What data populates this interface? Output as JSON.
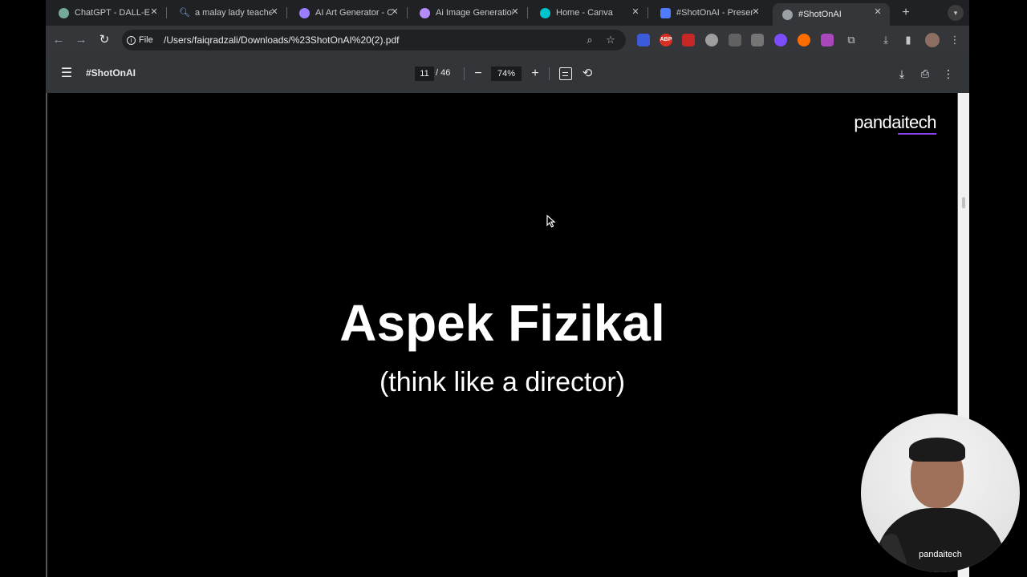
{
  "tabs": [
    {
      "title": "ChatGPT - DALL-E",
      "favicon_color": "#74aa9c"
    },
    {
      "title": "a malay lady teacher",
      "favicon_color": "#4285f4"
    },
    {
      "title": "AI Art Generator - Cr",
      "favicon_color": "#9c7cff"
    },
    {
      "title": "Ai Image Generation",
      "favicon_color": "#b58cff"
    },
    {
      "title": "Home - Canva",
      "favicon_color": "#00c4cc"
    },
    {
      "title": "#ShotOnAI - Presen",
      "favicon_color": "#4f7cff"
    },
    {
      "title": "#ShotOnAI",
      "favicon_color": "#9aa0a6",
      "active": true
    }
  ],
  "toolbar": {
    "file_chip": "File",
    "url": "/Users/faiqradzali/Downloads/%23ShotOnAI%20(2).pdf",
    "ext_abp": "ABP"
  },
  "pdf": {
    "title": "#ShotOnAI",
    "page_current": "11",
    "page_total": "/ 46",
    "zoom": "74%"
  },
  "slide": {
    "brand": "pandaitech",
    "heading": "Aspek Fizikal",
    "subheading": "(think like a director)"
  },
  "webcam": {
    "shirt_text": "pandaitech"
  }
}
